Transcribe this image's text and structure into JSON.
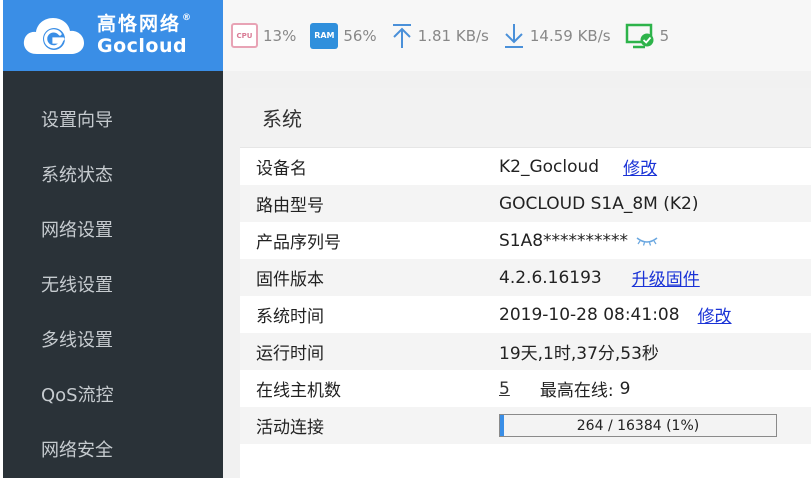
{
  "brand": {
    "name_cn": "高恪网络",
    "registered": "®",
    "name_en": "Gocloud",
    "color": "#3a8ee6"
  },
  "status": {
    "cpu_icon_label": "CPU",
    "cpu": "13%",
    "ram_icon_label": "RAM",
    "ram": "56%",
    "upload": "1.81 KB/s",
    "download": "14.59 KB/s",
    "online_count": "5"
  },
  "sidebar": {
    "items": [
      {
        "label": "设置向导"
      },
      {
        "label": "系统状态"
      },
      {
        "label": "网络设置"
      },
      {
        "label": "无线设置"
      },
      {
        "label": "多线设置"
      },
      {
        "label": "QoS流控"
      },
      {
        "label": "网络安全"
      }
    ]
  },
  "panel": {
    "title": "系统",
    "rows": {
      "device_name": {
        "label": "设备名",
        "value": "K2_Gocloud",
        "action": "修改"
      },
      "model": {
        "label": "路由型号",
        "value": "GOCLOUD S1A_8M (K2)"
      },
      "serial": {
        "label": "产品序列号",
        "value": "S1A8**********"
      },
      "firmware": {
        "label": "固件版本",
        "value": "4.2.6.16193",
        "action": "升级固件"
      },
      "system_time": {
        "label": "系统时间",
        "value": "2019-10-28 08:41:08",
        "action": "修改"
      },
      "uptime": {
        "label": "运行时间",
        "value": "19天,1时,37分,53秒"
      },
      "online_hosts": {
        "label": "在线主机数",
        "value": "5",
        "max_label": "最高在线:",
        "max_value": "9"
      },
      "connections": {
        "label": "活动连接",
        "value": "264 / 16384 (1%)",
        "fraction": 0.016
      }
    }
  },
  "icons": {
    "cpu": "cpu-icon",
    "ram": "ram-icon",
    "upload": "upload-arrow-icon",
    "download": "download-arrow-icon",
    "online": "monitor-check-icon",
    "reveal": "eye-closed-icon"
  }
}
